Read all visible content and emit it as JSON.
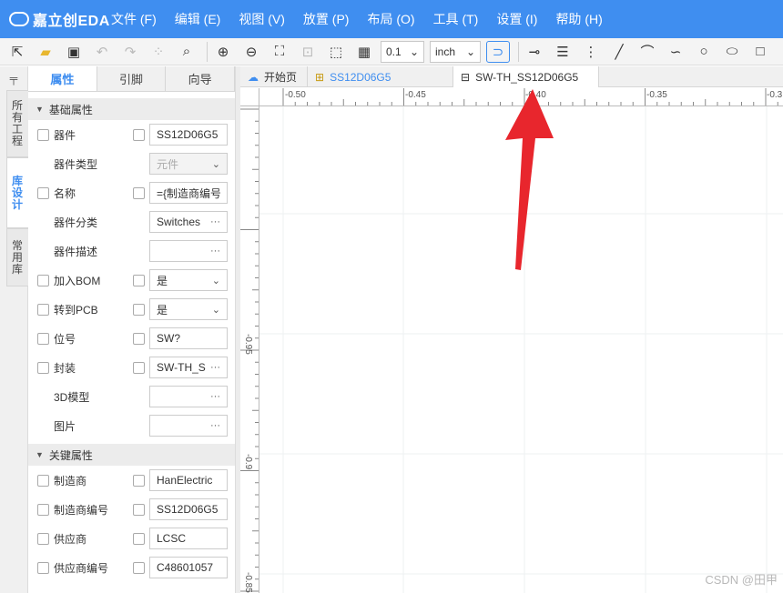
{
  "app": {
    "logo_text": "嘉立创EDA"
  },
  "menu": [
    "文件 (F)",
    "编辑 (E)",
    "视图 (V)",
    "放置 (P)",
    "布局 (O)",
    "工具 (T)",
    "设置 (I)",
    "帮助 (H)"
  ],
  "toolbar": {
    "grid_value": "0.1",
    "unit_value": "inch"
  },
  "left_tabs": {
    "pin_glyph": "📌",
    "projects": "所有工程",
    "library_design": "库设计",
    "common_library": "常用库"
  },
  "panel": {
    "tabs": [
      "属性",
      "引脚",
      "向导"
    ],
    "section_basic": "基础属性",
    "section_key": "关键属性",
    "rows_basic": [
      {
        "label": "器件",
        "value": "SS12D06G5",
        "checkbox": true,
        "value_checkbox": true,
        "icon": ""
      },
      {
        "label": "器件类型",
        "value": "元件",
        "checkbox": false,
        "value_checkbox": false,
        "icon": "⌄",
        "disabled": true
      },
      {
        "label": "名称",
        "value": "={制造商编号",
        "checkbox": true,
        "value_checkbox": true,
        "icon": ""
      },
      {
        "label": "器件分类",
        "value": "Switches",
        "checkbox": false,
        "value_checkbox": false,
        "icon": "···"
      },
      {
        "label": "器件描述",
        "value": "",
        "checkbox": false,
        "value_checkbox": false,
        "icon": "···"
      },
      {
        "label": "加入BOM",
        "value": "是",
        "checkbox": true,
        "value_checkbox": true,
        "icon": "⌄"
      },
      {
        "label": "转到PCB",
        "value": "是",
        "checkbox": true,
        "value_checkbox": true,
        "icon": "⌄"
      },
      {
        "label": "位号",
        "value": "SW?",
        "checkbox": true,
        "value_checkbox": true,
        "icon": ""
      },
      {
        "label": "封装",
        "value": "SW-TH_S",
        "checkbox": true,
        "value_checkbox": true,
        "icon": "···"
      },
      {
        "label": "3D模型",
        "value": "",
        "checkbox": false,
        "value_checkbox": false,
        "icon": "···"
      },
      {
        "label": "图片",
        "value": "",
        "checkbox": false,
        "value_checkbox": false,
        "icon": "···"
      }
    ],
    "rows_key": [
      {
        "label": "制造商",
        "value": "HanElectric",
        "checkbox": true,
        "value_checkbox": true,
        "icon": ""
      },
      {
        "label": "制造商编号",
        "value": "SS12D06G5",
        "checkbox": true,
        "value_checkbox": true,
        "icon": ""
      },
      {
        "label": "供应商",
        "value": "LCSC",
        "checkbox": true,
        "value_checkbox": true,
        "icon": ""
      },
      {
        "label": "供应商编号",
        "value": "C48601057",
        "checkbox": true,
        "value_checkbox": true,
        "icon": ""
      }
    ]
  },
  "doc_tabs": [
    {
      "label": "开始页",
      "icon": "cloud-icon"
    },
    {
      "label": "SS12D06G5",
      "icon": "symbol-icon"
    },
    {
      "label": "SW-TH_SS12D06G5",
      "icon": "footprint-icon"
    }
  ],
  "ruler": {
    "top": [
      "-0.50",
      "-0.45",
      "-0.40",
      "-0.35",
      "-0.3"
    ],
    "left": [
      "-0.95",
      "-0.9",
      "-0.85"
    ]
  },
  "watermark": "CSDN @田甲",
  "colors": {
    "accent": "#3f8ef0",
    "arrow": "#e8262d"
  }
}
